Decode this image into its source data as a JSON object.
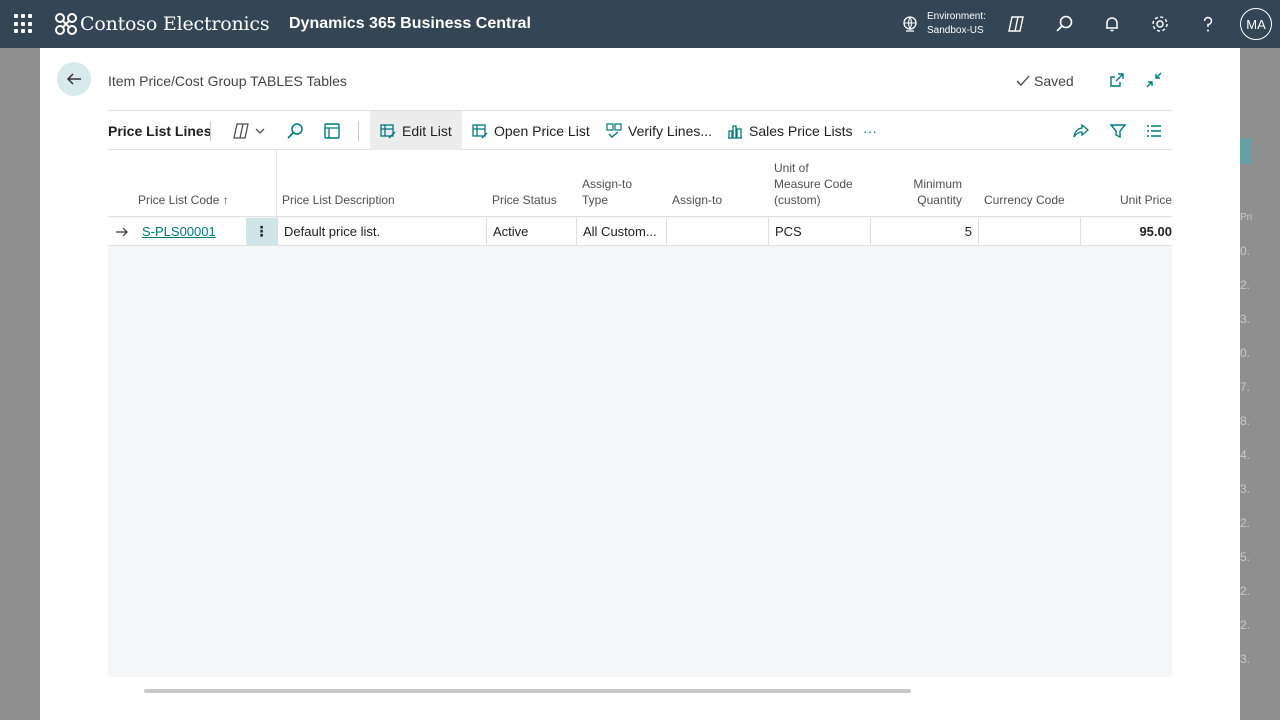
{
  "appbar": {
    "brand": "Contoso Electronics",
    "product": "Dynamics 365 Business Central",
    "environment_label": "Environment:",
    "environment_value": "Sandbox-US",
    "avatar_initials": "MA",
    "bg_color": "#344555"
  },
  "dialog": {
    "title": "Item Price/Cost Group TABLES Tables",
    "saved_label": "Saved"
  },
  "actionbar": {
    "title": "Price List Lines",
    "edit_list": "Edit List",
    "open_price_list": "Open Price List",
    "verify_lines": "Verify Lines...",
    "sales_price_lists": "Sales Price Lists",
    "more": "···"
  },
  "grid": {
    "columns": {
      "price_list_code": "Price List Code",
      "price_list_description": "Price List Description",
      "price_status": "Price Status",
      "assign_to_type_1": "Assign-to",
      "assign_to_type_2": "Type",
      "assign_to": "Assign-to",
      "uom_1": "Unit of",
      "uom_2": "Measure Code",
      "uom_3": "(custom)",
      "min_qty_1": "Minimum",
      "min_qty_2": "Quantity",
      "currency_code": "Currency Code",
      "unit_price": "Unit Price"
    },
    "sort_indicator": "↑",
    "rows": [
      {
        "price_list_code": "S-PLS00001",
        "price_list_description": "Default price list.",
        "price_status": "Active",
        "assign_to_type": "All Custom...",
        "assign_to": "",
        "uom": "PCS",
        "min_qty": "5",
        "currency_code": "",
        "unit_price": "95.00"
      }
    ]
  },
  "background_page": {
    "column_label": "Pri",
    "values": [
      "0.",
      "2.",
      "3.",
      "0.",
      "7.",
      "8.",
      "4.",
      "3.",
      "2.",
      "5.",
      "2.",
      "2.",
      "3."
    ]
  },
  "colors": {
    "accent": "#00797d",
    "selected_cell": "#cfe5e8"
  }
}
